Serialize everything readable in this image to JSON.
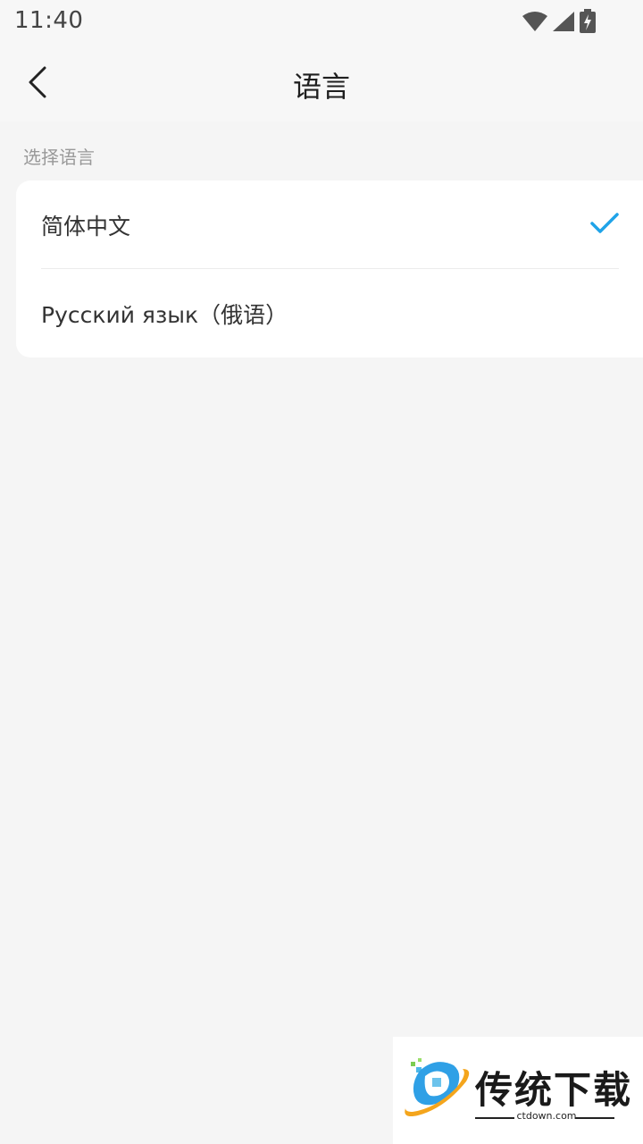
{
  "status_bar": {
    "time": "11:40"
  },
  "header": {
    "title": "语言"
  },
  "language_section": {
    "label": "选择语言",
    "items": [
      {
        "label": "简体中文",
        "selected": true
      },
      {
        "label": "Русский язык（俄语）",
        "selected": false
      }
    ]
  },
  "watermark": {
    "name": "传统下载",
    "domain": "ctdown.com"
  },
  "colors": {
    "accent": "#1fa3e8",
    "background": "#f5f5f5",
    "card": "#ffffff",
    "text_primary": "#333333",
    "text_secondary": "#999999"
  },
  "icons": {
    "back": "chevron-left-icon",
    "selected": "checkmark-icon",
    "wifi": "wifi-icon",
    "signal": "signal-icon",
    "battery": "battery-charging-icon"
  }
}
